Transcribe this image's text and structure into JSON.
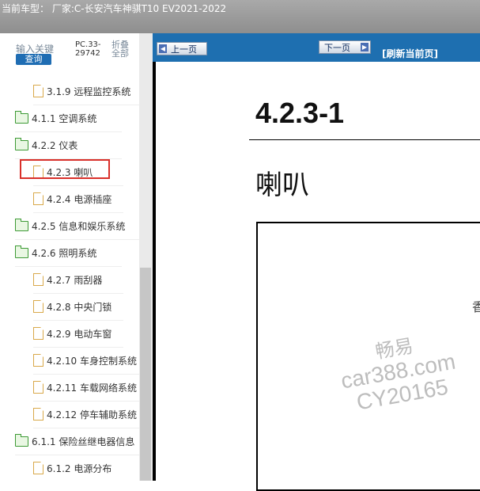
{
  "window": {
    "title": "当前车型： 厂家:C-长安汽车神骐T10 EV2021-2022"
  },
  "sidebar": {
    "keyword_label": "输入关键",
    "query_label": "查询",
    "pc_code": "PC.33-29742",
    "collapse_label": "折叠全部",
    "tree_items": [
      {
        "label": "3.1.9 远程监控系统",
        "type": "doc"
      },
      {
        "label": "4.1.1 空调系统",
        "type": "folder"
      },
      {
        "label": "4.2.2 仪表",
        "type": "folder"
      },
      {
        "label": "4.2.3 喇叭",
        "type": "doc",
        "selected": true
      },
      {
        "label": "4.2.4 电源插座",
        "type": "doc"
      },
      {
        "label": "4.2.5 信息和娱乐系统",
        "type": "folder"
      },
      {
        "label": "4.2.6 照明系统",
        "type": "folder"
      },
      {
        "label": "4.2.7 雨刮器",
        "type": "doc"
      },
      {
        "label": "4.2.8 中央门锁",
        "type": "doc"
      },
      {
        "label": "4.2.9 电动车窗",
        "type": "doc"
      },
      {
        "label": "4.2.10 车身控制系统",
        "type": "doc"
      },
      {
        "label": "4.2.11 车载网络系统",
        "type": "doc"
      },
      {
        "label": "4.2.12 停车辅助系统",
        "type": "doc"
      },
      {
        "label": "6.1.1 保险丝继电器信息",
        "type": "folder"
      },
      {
        "label": "6.1.2 电源分布",
        "type": "doc"
      }
    ]
  },
  "toolbar": {
    "prev_label": "上一页",
    "next_label": "下一页",
    "refresh_label": "[刷新当前页]"
  },
  "document": {
    "code": "4.2.3-1",
    "title": "喇叭",
    "partial_glyph": "香"
  },
  "watermark": {
    "line1": "畅易",
    "line2": "car388.com",
    "line3": "CY20165"
  },
  "colors": {
    "toolbar_blue": "#1e6fb0",
    "selected_border": "#d9302a",
    "folder_green": "#3d9a35",
    "doc_orange": "#d9a94b"
  }
}
